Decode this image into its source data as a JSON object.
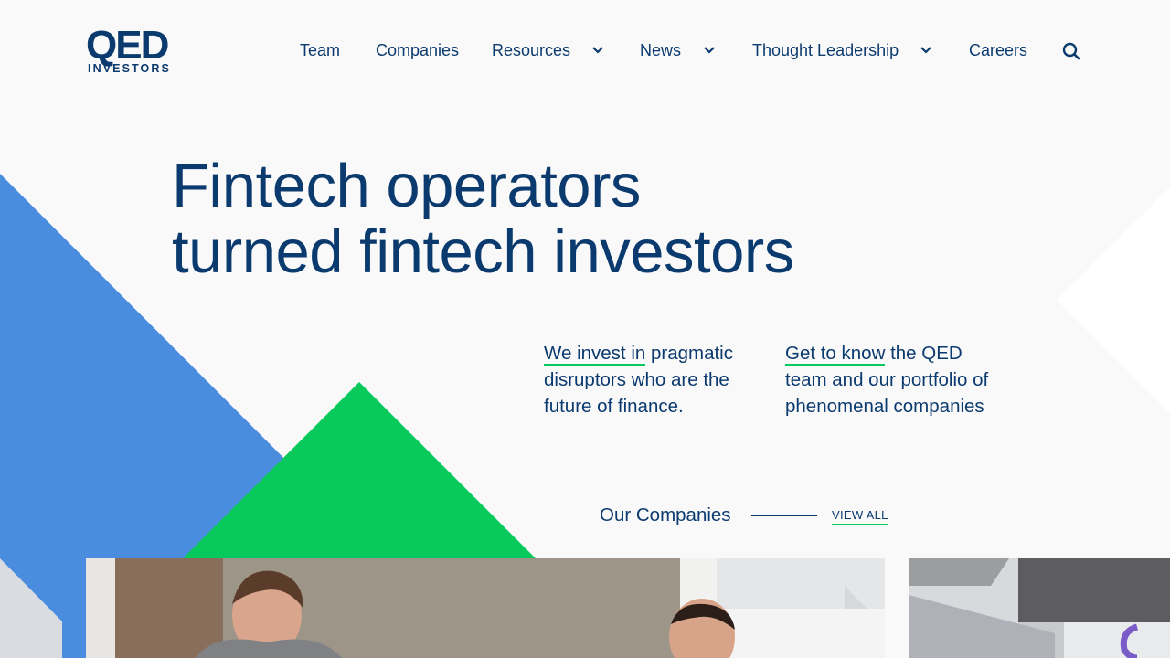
{
  "brand": {
    "logo_main": "QED",
    "logo_sub": "INVESTORS"
  },
  "nav": {
    "items": [
      {
        "label": "Team",
        "has_dropdown": false
      },
      {
        "label": "Companies",
        "has_dropdown": false
      },
      {
        "label": "Resources",
        "has_dropdown": true
      },
      {
        "label": "News",
        "has_dropdown": true
      },
      {
        "label": "Thought Leadership",
        "has_dropdown": true
      },
      {
        "label": "Careers",
        "has_dropdown": false
      }
    ],
    "search_icon": "search-icon",
    "dropdown_icon": "chevron-down-icon"
  },
  "hero": {
    "title_line1": "Fintech operators",
    "title_line2": "turned fintech investors"
  },
  "blurbs": [
    {
      "link_text": "We invest in",
      "rest": " pragmatic disruptors who are the future of finance."
    },
    {
      "link_text": "Get to know",
      "rest": " the QED team and our portfolio of phenomenal companies"
    }
  ],
  "companies": {
    "heading": "Our Companies",
    "view_all": "VIEW ALL"
  },
  "colors": {
    "navy": "#0b3a6e",
    "blue": "#4a8ddf",
    "green": "#08c95c",
    "background": "#f9f9fa",
    "accent_underline": "#08c95c"
  }
}
